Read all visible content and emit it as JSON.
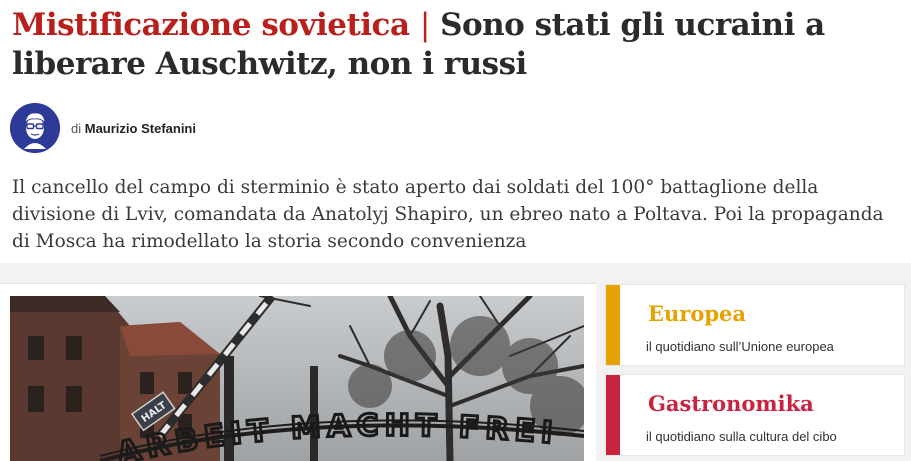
{
  "article": {
    "kicker": "Mistificazione sovietica",
    "separator": "|",
    "title": "Sono stati gli ucraini a liberare Auschwitz, non i russi",
    "byline_prefix": "di",
    "author": "Maurizio Stefanini",
    "summary": "Il cancello del campo di sterminio è stato aperto dai soldati del 100° battaglione della divisione di Lviv, comandata da Anatolyj Shapiro, un ebreo nato a Poltava. Poi la propaganda di Mosca ha rimodellato la storia secondo convenienza",
    "photo": {
      "gate_sign_text": "ARBEIT MACHT FREI",
      "barrier_sign_text": "HALT"
    }
  },
  "promos": [
    {
      "title": "Europea",
      "subtitle": "il quotidiano sull’Unione europea",
      "accent": "#e8a200"
    },
    {
      "title": "Gastronomika",
      "subtitle": "il quotidiano sulla cultura del cibo",
      "accent": "#c8233f"
    }
  ],
  "colors": {
    "kicker": "#b8201c",
    "avatar_bg": "#2e3a97"
  }
}
